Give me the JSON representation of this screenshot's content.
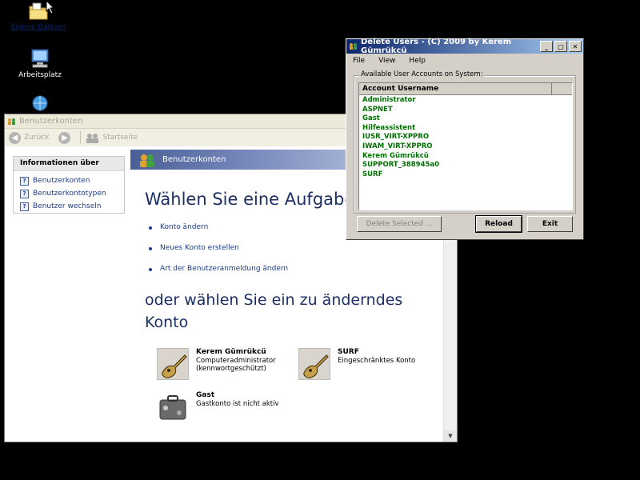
{
  "desktop": {
    "icons": [
      {
        "label": "Eigene Dateien",
        "icon": "folder-documents-icon"
      },
      {
        "label": "Arbeitsplatz",
        "icon": "computer-icon"
      },
      {
        "label": "",
        "icon": "network-icon"
      }
    ]
  },
  "benutzerkonten": {
    "title": "Benutzerkonten",
    "toolbar": {
      "back": "Zurück",
      "home": "Startseite"
    },
    "info_panel": {
      "title": "Informationen über",
      "items": [
        "Benutzerkonten",
        "Benutzerkontotypen",
        "Benutzer wechseln"
      ]
    },
    "banner": "Benutzerkonten",
    "heading": "Wählen Sie eine Aufgabe...",
    "tasks": [
      "Konto ändern",
      "Neues Konto erstellen",
      "Art der Benutzeranmeldung ändern"
    ],
    "heading2": "oder wählen Sie ein zu änderndes Konto",
    "accounts": [
      {
        "name": "Kerem Gümrükcü",
        "type": "Computeradministrator",
        "note": "(kennwortgeschützt)"
      },
      {
        "name": "SURF",
        "type": "Eingeschränktes Konto",
        "note": ""
      },
      {
        "name": "Gast",
        "type": "Gastkonto ist nicht aktiv",
        "note": ""
      }
    ]
  },
  "delete_users": {
    "title": "Delete Users - (C) 2009 by Kerem Gümrükcü",
    "menu": [
      "File",
      "View",
      "Help"
    ],
    "group_label": "Available User Accounts on System:",
    "column_header": "Account Username",
    "users": [
      "Administrator",
      "ASPNET",
      "Gast",
      "Hilfeassistent",
      "IUSR_VIRT-XPPRO",
      "IWAM_VIRT-XPPRO",
      "Kerem Gümrükcü",
      "SUPPORT_388945a0",
      "SURF"
    ],
    "buttons": {
      "delete": "Delete Selected ...",
      "reload": "Reload",
      "exit": "Exit"
    },
    "user_color": "#007000"
  }
}
